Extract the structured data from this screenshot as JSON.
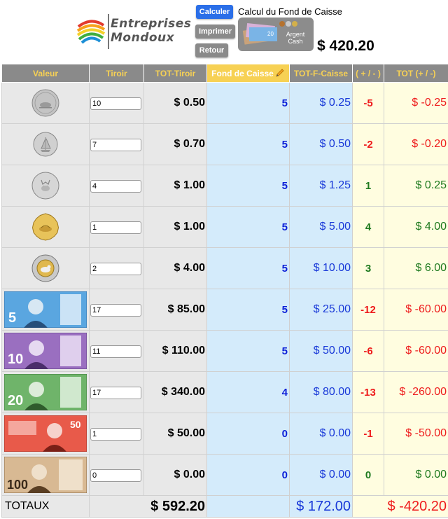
{
  "header": {
    "logo_line1": "Entreprises",
    "logo_line2": "Mondoux",
    "buttons": {
      "calculate": "Calculer",
      "print": "Imprimer",
      "back": "Retour"
    },
    "title": "Calcul du Fond de Caisse",
    "cash_card_label_1": "Argent",
    "cash_card_label_2": "Cash",
    "grand_total": "$ 420.20"
  },
  "table": {
    "headers": {
      "valeur": "Valeur",
      "tiroir": "Tiroir",
      "tot_tiroir": "TOT-Tiroir",
      "fond_caisse": "Fond de Caisse",
      "tot_f_caisse": "TOT-F-Caisse",
      "plus_minus": "( + / - )",
      "tot_plus_minus": "TOT (+ / -)"
    },
    "rows": [
      {
        "denom": "nickel-coin",
        "tiroir": "10",
        "tot_tiroir": "$ 0.50",
        "fond": "5",
        "tot_f": "$ 0.25",
        "pm": "-5",
        "tot_pm": "$ -0.25"
      },
      {
        "denom": "dime-coin",
        "tiroir": "7",
        "tot_tiroir": "$ 0.70",
        "fond": "5",
        "tot_f": "$ 0.50",
        "pm": "-2",
        "tot_pm": "$ -0.20"
      },
      {
        "denom": "quarter-coin",
        "tiroir": "4",
        "tot_tiroir": "$ 1.00",
        "fond": "5",
        "tot_f": "$ 1.25",
        "pm": "1",
        "tot_pm": "$ 0.25"
      },
      {
        "denom": "loonie-coin",
        "tiroir": "1",
        "tot_tiroir": "$ 1.00",
        "fond": "5",
        "tot_f": "$ 5.00",
        "pm": "4",
        "tot_pm": "$ 4.00"
      },
      {
        "denom": "toonie-coin",
        "tiroir": "2",
        "tot_tiroir": "$ 4.00",
        "fond": "5",
        "tot_f": "$ 10.00",
        "pm": "3",
        "tot_pm": "$ 6.00"
      },
      {
        "denom": "5-dollar-bill",
        "tiroir": "17",
        "tot_tiroir": "$ 85.00",
        "fond": "5",
        "tot_f": "$ 25.00",
        "pm": "-12",
        "tot_pm": "$ -60.00"
      },
      {
        "denom": "10-dollar-bill",
        "tiroir": "11",
        "tot_tiroir": "$ 110.00",
        "fond": "5",
        "tot_f": "$ 50.00",
        "pm": "-6",
        "tot_pm": "$ -60.00"
      },
      {
        "denom": "20-dollar-bill",
        "tiroir": "17",
        "tot_tiroir": "$ 340.00",
        "fond": "4",
        "tot_f": "$ 80.00",
        "pm": "-13",
        "tot_pm": "$ -260.00"
      },
      {
        "denom": "50-dollar-bill",
        "tiroir": "1",
        "tot_tiroir": "$ 50.00",
        "fond": "0",
        "tot_f": "$ 0.00",
        "pm": "-1",
        "tot_pm": "$ -50.00"
      },
      {
        "denom": "100-dollar-bill",
        "tiroir": "0",
        "tot_tiroir": "$ 0.00",
        "fond": "0",
        "tot_f": "$ 0.00",
        "pm": "0",
        "tot_pm": "$ 0.00"
      }
    ],
    "bill_labels": {
      "b5": "5",
      "b10": "10",
      "b20": "20",
      "b50": "50",
      "b100": "100"
    },
    "totals": {
      "label": "TOTAUX",
      "tot_tiroir": "$ 592.20",
      "tot_f_caisse": "$ 172.00",
      "tot_plus_minus": "$ -420.20"
    }
  },
  "colors": {
    "header_bg": "#8a8a8a",
    "header_text": "#f7d154",
    "calc_button": "#2b6fe8",
    "negative": "#ee1c1c",
    "positive": "#1f7a1f",
    "fond_blue": "#0c1fd8",
    "cell_blue_bg": "#d4ebfb",
    "cell_yellow_bg": "#fffde0"
  }
}
